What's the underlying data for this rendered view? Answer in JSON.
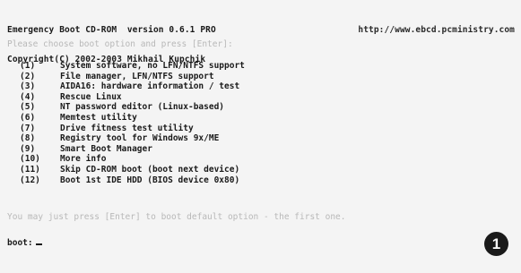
{
  "header": {
    "title_line": "Emergency Boot CD-ROM  version 0.6.1 PRO",
    "url": "http://www.ebcd.pcministry.com",
    "copyright": "Copyright(C) 2002-2003 Mikhail Kupchik"
  },
  "prompt": "Please choose boot option and press [Enter]:",
  "menu": {
    "items": [
      {
        "key": "(1)",
        "label": "System software, no LFN/NTFS support"
      },
      {
        "key": "(2)",
        "label": "File manager, LFN/NTFS support"
      },
      {
        "key": "(3)",
        "label": "AIDA16: hardware information / test"
      },
      {
        "key": "(4)",
        "label": "Rescue Linux"
      },
      {
        "key": "(5)",
        "label": "NT password editor (Linux-based)"
      },
      {
        "key": "(6)",
        "label": "Memtest utility"
      },
      {
        "key": "(7)",
        "label": "Drive fitness test utility"
      },
      {
        "key": "(8)",
        "label": "Registry tool for Windows 9x/ME"
      },
      {
        "key": "(9)",
        "label": "Smart Boot Manager"
      },
      {
        "key": "(10)",
        "label": "More info"
      },
      {
        "key": "(11)",
        "label": "Skip CD-ROM boot (boot next device)"
      },
      {
        "key": "(12)",
        "label": "Boot 1st IDE HDD (BIOS device 0x80)"
      }
    ]
  },
  "hint": "You may just press [Enter] to boot default option - the first one.",
  "boot_prompt": "boot:",
  "badge": "1"
}
